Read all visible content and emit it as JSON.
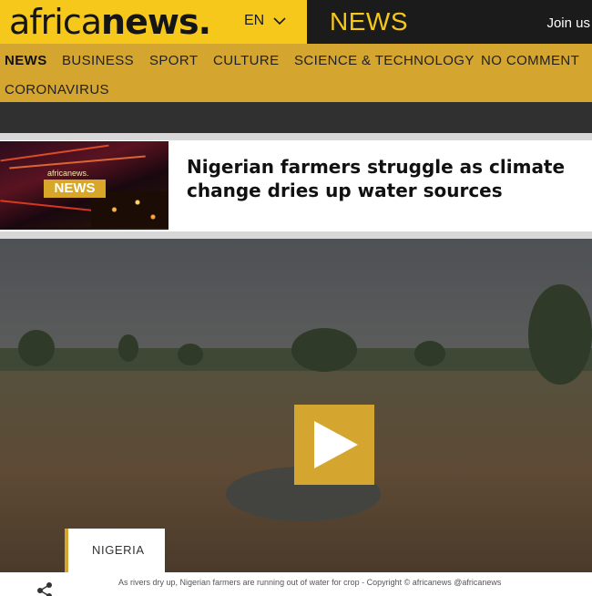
{
  "header": {
    "logo_thin": "africa",
    "logo_bold": "news.",
    "language": "EN",
    "section_title": "NEWS",
    "join_label": "Join us"
  },
  "nav": {
    "items": [
      {
        "label": "NEWS",
        "active": true
      },
      {
        "label": "BUSINESS"
      },
      {
        "label": "SPORT"
      },
      {
        "label": "CULTURE"
      },
      {
        "label": "SCIENCE & TECHNOLOGY"
      },
      {
        "label": "NO COMMENT"
      },
      {
        "label": "CORONAVIRUS"
      }
    ]
  },
  "article": {
    "thumbnail_brand": "africanews.",
    "thumbnail_label": "NEWS",
    "headline": "Nigerian farmers struggle as climate change dries up water sources"
  },
  "video": {
    "tag": "NIGERIA",
    "caption": "As rivers dry up, Nigerian farmers are running out of water for crop  -  Copyright © africanews  @africanews"
  },
  "colors": {
    "accent": "#d4a52f",
    "brand_yellow": "#f6c81c",
    "dark": "#1b1b1b"
  },
  "icons": {
    "language_toggle": "chevron-down-icon",
    "play": "play-icon",
    "share": "share-icon"
  }
}
